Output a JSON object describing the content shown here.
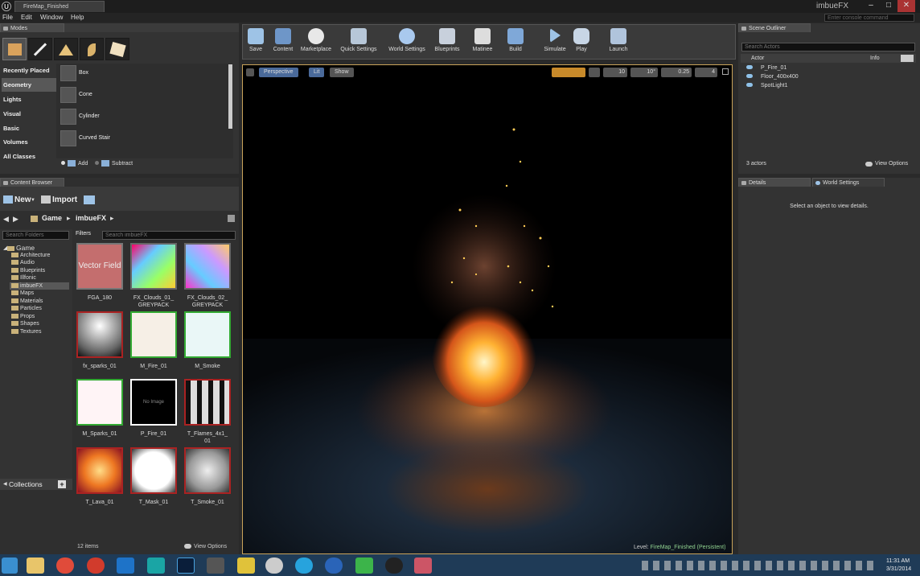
{
  "window": {
    "tab_title": "FireMap_Finished",
    "app_name": "imbueFX",
    "console_placeholder": "Enter console command"
  },
  "menu": [
    "File",
    "Edit",
    "Window",
    "Help"
  ],
  "modes": {
    "tab": "Modes",
    "categories": [
      "Recently Placed",
      "Geometry",
      "Lights",
      "Visual",
      "Basic",
      "Volumes",
      "All Classes"
    ],
    "selected_category": "Geometry",
    "items": [
      "Box",
      "Cone",
      "Cylinder",
      "Curved Stair"
    ],
    "add_label": "Add",
    "subtract_label": "Subtract"
  },
  "toolbar": [
    {
      "label": "Save",
      "icon": "save-icon"
    },
    {
      "label": "Content",
      "icon": "content-icon"
    },
    {
      "label": "Marketplace",
      "icon": "marketplace-icon"
    },
    {
      "label": "Quick Settings",
      "icon": "quick-settings-icon"
    },
    {
      "label": "World Settings",
      "icon": "world-settings-icon"
    },
    {
      "label": "Blueprints",
      "icon": "blueprints-icon"
    },
    {
      "label": "Matinee",
      "icon": "matinee-icon"
    },
    {
      "label": "Build",
      "icon": "build-icon"
    },
    {
      "label": "Simulate",
      "icon": "simulate-icon"
    },
    {
      "label": "Play",
      "icon": "play-icon"
    },
    {
      "label": "Launch",
      "icon": "launch-icon"
    }
  ],
  "viewport": {
    "perspective_label": "Perspective",
    "lit_label": "Lit",
    "show_label": "Show",
    "grid_snap": "10",
    "rot_snap": "10°",
    "scale_snap": "0.25",
    "camera_speed": "4",
    "level_label": "Level:",
    "level_name": "FireMap_Finished (Persistent)"
  },
  "content_browser": {
    "tab": "Content Browser",
    "new_label": "New",
    "import_label": "Import",
    "path": [
      "Game",
      "imbueFX"
    ],
    "search_folders_placeholder": "Search Folders",
    "filters_label": "Filters",
    "search_assets_placeholder": "Search imbueFX",
    "folders": [
      "Game",
      "Architecture",
      "Audio",
      "Blueprints",
      "Illfonic",
      "imbueFX",
      "Maps",
      "Materials",
      "Particles",
      "Props",
      "Shapes",
      "Textures"
    ],
    "assets": [
      {
        "name": "FGA_180",
        "thumb_text": "Vector Field"
      },
      {
        "name": "FX_Clouds_01_ GREYPACK"
      },
      {
        "name": "FX_Clouds_02_ GREYPACK"
      },
      {
        "name": "fx_sparks_01"
      },
      {
        "name": "M_Fire_01"
      },
      {
        "name": "M_Smoke"
      },
      {
        "name": "M_Sparks_01"
      },
      {
        "name": "P_Fire_01",
        "thumb_text": "No Image"
      },
      {
        "name": "T_Flames_4x1_ 01"
      },
      {
        "name": "T_Lava_01"
      },
      {
        "name": "T_Mask_01"
      },
      {
        "name": "T_Smoke_01"
      }
    ],
    "collections_label": "Collections",
    "item_count": "12 items",
    "view_options": "View Options"
  },
  "scene_outliner": {
    "tab": "Scene Outliner",
    "search_placeholder": "Search Actors",
    "col_actor": "Actor",
    "col_info": "Info",
    "actors": [
      "P_Fire_01",
      "Floor_400x400",
      "SpotLight1"
    ],
    "count": "3 actors",
    "view_options": "View Options"
  },
  "details": {
    "tab": "Details",
    "world_settings_tab": "World Settings",
    "empty_message": "Select an object to view details."
  },
  "taskbar": {
    "time": "11:31 AM",
    "date": "3/31/2014"
  }
}
